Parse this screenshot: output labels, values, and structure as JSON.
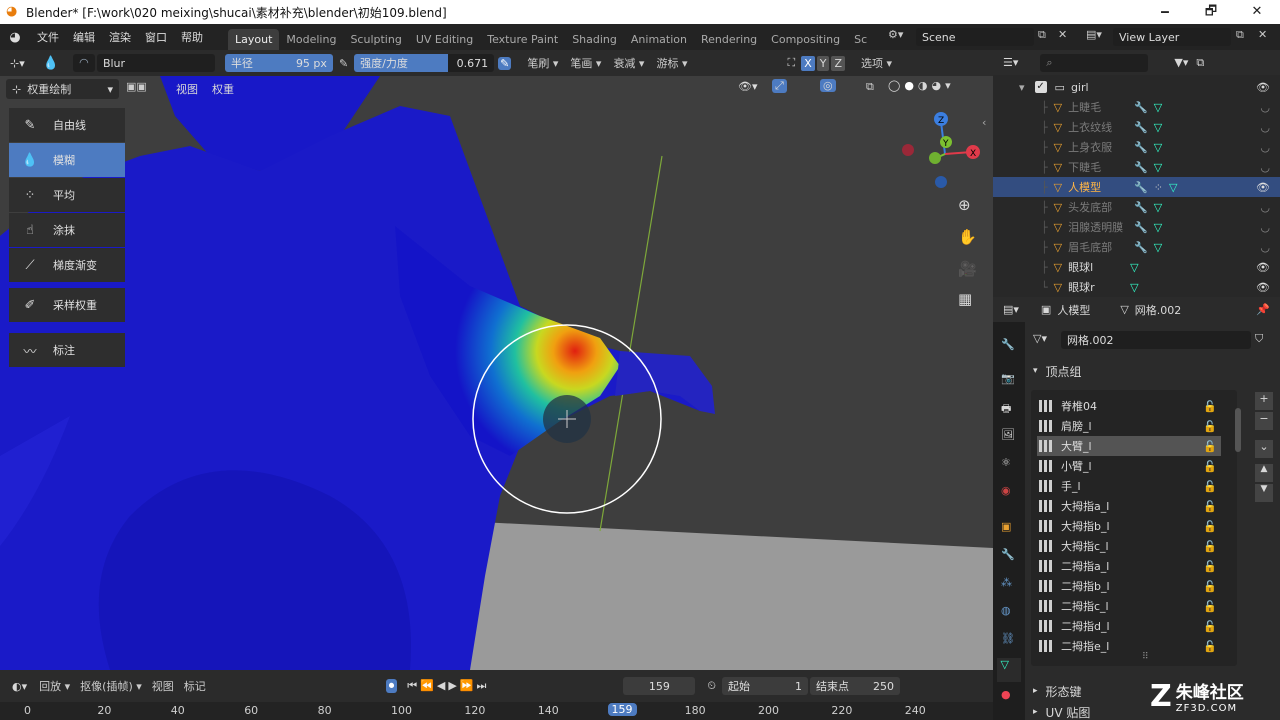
{
  "titlebar": {
    "title": "Blender* [F:\\work\\020 meixing\\shucai\\素材补充\\blender\\初始109.blend]",
    "minimize": "🗕",
    "maximize": "🗗",
    "close": "✕"
  },
  "menu": {
    "items": [
      "文件",
      "编辑",
      "渲染",
      "窗口",
      "帮助"
    ]
  },
  "workspaces": {
    "tabs": [
      "Layout",
      "Modeling",
      "Sculpting",
      "UV Editing",
      "Texture Paint",
      "Shading",
      "Animation",
      "Rendering",
      "Compositing",
      "Sc"
    ],
    "active": "Layout"
  },
  "scene": {
    "label": "Scene",
    "view_layer": "View Layer"
  },
  "toolheader": {
    "brush_name": "Blur",
    "radius_label": "半径",
    "radius_value": "95 px",
    "strength_label": "强度/力度",
    "strength_value": "0.671",
    "brush_dd": "笔刷",
    "stroke_dd": "笔画",
    "falloff_dd": "衰减",
    "cursor_dd": "游标",
    "axes": [
      "X",
      "Y",
      "Z"
    ],
    "options_dd": "选项"
  },
  "viewport_header": {
    "mode": "权重绘制",
    "view": "视图",
    "weights": "权重"
  },
  "tools": [
    {
      "label": "自由线",
      "icon": "brush-icon"
    },
    {
      "label": "模糊",
      "icon": "drop-icon",
      "active": true
    },
    {
      "label": "平均",
      "icon": "average-icon"
    },
    {
      "label": "涂抹",
      "icon": "smear-icon"
    },
    {
      "label": "梯度渐变",
      "icon": "gradient-icon"
    },
    {
      "label": "采样权重",
      "icon": "eyedropper-icon"
    },
    {
      "label": "标注",
      "icon": "annotate-icon"
    }
  ],
  "gizmo": {
    "x": "X",
    "y": "Y",
    "z": "Z"
  },
  "outliner": {
    "root": "girl",
    "items": [
      {
        "label": "上睫毛",
        "dim": true
      },
      {
        "label": "上衣纹线",
        "dim": true
      },
      {
        "label": "上身衣服",
        "dim": true
      },
      {
        "label": "下睫毛",
        "dim": true
      },
      {
        "label": "人模型",
        "dim": false,
        "selected": true
      },
      {
        "label": "头发底部",
        "dim": true
      },
      {
        "label": "泪腺透明膜",
        "dim": true
      },
      {
        "label": "眉毛底部",
        "dim": true
      },
      {
        "label": "眼球l",
        "dim": false
      },
      {
        "label": "眼球r",
        "dim": false
      }
    ]
  },
  "properties": {
    "object": "人模型",
    "mesh": "网格.002",
    "mesh_field": "网格.002",
    "vertex_groups_title": "顶点组",
    "vertex_groups": [
      "脊椎04",
      "肩膀_l",
      "大臂_l",
      "小臂_l",
      "手_l",
      "大拇指a_l",
      "大拇指b_l",
      "大拇指c_l",
      "二拇指a_l",
      "二拇指b_l",
      "二拇指c_l",
      "二拇指d_l",
      "二拇指e_l"
    ],
    "selected_group": "大臂_l",
    "shape_keys": "形态键",
    "uv_maps": "UV 贴图"
  },
  "timeline": {
    "playback": "回放",
    "keying": "抠像(插帧)",
    "view": "视图",
    "marker": "标记",
    "current_frame": "159",
    "start_label": "起始",
    "start": "1",
    "end_label": "结束点",
    "end": "250",
    "ticks": [
      "0",
      "20",
      "40",
      "60",
      "80",
      "100",
      "120",
      "140",
      "159",
      "180",
      "200",
      "220",
      "240"
    ]
  },
  "watermark": {
    "brand": "朱峰社区",
    "url": "ZF3D.COM"
  }
}
